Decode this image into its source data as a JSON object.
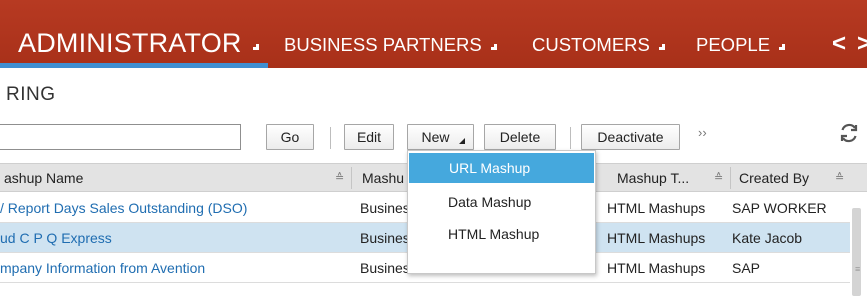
{
  "nav": {
    "main_tab": "ADMINISTRATOR",
    "tabs": [
      "BUSINESS PARTNERS",
      "CUSTOMERS",
      "PEOPLE"
    ],
    "prev_arrow": "<",
    "next_arrow": ">"
  },
  "page": {
    "title": "RING"
  },
  "toolbar": {
    "search_value": "",
    "go": "Go",
    "edit": "Edit",
    "new": "New",
    "delete": "Delete",
    "deactivate": "Deactivate",
    "more": "››",
    "refresh_icon": "refresh-icon"
  },
  "table": {
    "headers": {
      "name": "ashup Name",
      "category": "Mashu",
      "type": "Mashup T...",
      "created_by": "Created By"
    },
    "rows": [
      {
        "name": "/ Report Days Sales Outstanding (DSO)",
        "category": "Busines",
        "type": "HTML Mashups",
        "created_by": "SAP WORKER"
      },
      {
        "name": "ud C P Q Express",
        "category": "Busines",
        "type": "HTML Mashups",
        "created_by": "Kate Jacob"
      },
      {
        "name": "mpany Information from Avention",
        "category": "Business & Finance",
        "type": "HTML Mashups",
        "created_by": "SAP"
      }
    ]
  },
  "new_menu": {
    "items": [
      "URL Mashup",
      "Data Mashup",
      "HTML Mashup"
    ],
    "active_index": 0
  },
  "colors": {
    "nav_background": "#b0361f",
    "tab_underline": "#3f8fd2",
    "link": "#1f6db1",
    "selected_row": "#cfe3f1",
    "menu_highlight": "#45a8dd"
  }
}
